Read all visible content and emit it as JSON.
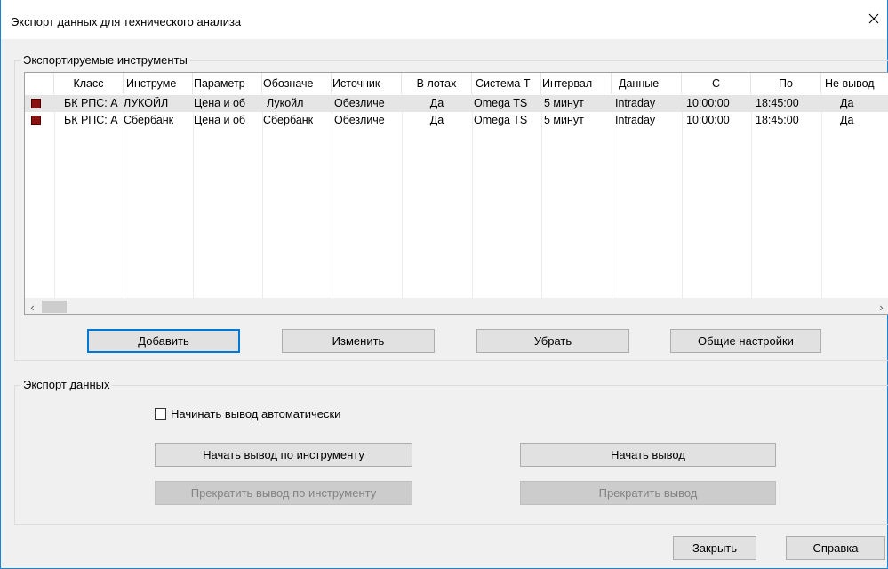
{
  "window": {
    "title": "Экспорт данных для технического анализа",
    "close_symbol": "✕"
  },
  "instruments_group": {
    "legend": "Экспортируемые инструменты",
    "columns": [
      "",
      "Класс",
      "Инструме",
      "Параметр",
      "Обозначе",
      "Источник",
      "В лотах",
      "Система Т",
      "Интервал",
      "Данные",
      "С",
      "По",
      "Не вывод"
    ],
    "rows": [
      {
        "selected": true,
        "icon": "instrument-icon",
        "cells": [
          "БК РПС: А",
          "ЛУКОЙЛ",
          "Цена и об",
          "Лукойл",
          "Обезличе",
          "Да",
          "Omega TS",
          "5 минут",
          "Intraday",
          "10:00:00",
          "18:45:00",
          "Да"
        ]
      },
      {
        "selected": false,
        "icon": "instrument-icon",
        "cells": [
          "БК РПС: А",
          "Сбербанк",
          "Цена и об",
          "Сбербанк",
          "Обезличе",
          "Да",
          "Omega TS",
          "5 минут",
          "Intraday",
          "10:00:00",
          "18:45:00",
          "Да"
        ]
      }
    ],
    "scroll_left": "‹",
    "scroll_right": "›",
    "buttons": {
      "add": "Добавить",
      "edit": "Изменить",
      "remove": "Убрать",
      "settings": "Общие настройки"
    }
  },
  "export_group": {
    "legend": "Экспорт данных",
    "auto_start_label": "Начинать вывод автоматически",
    "auto_start_checked": false,
    "buttons": {
      "start_instrument": "Начать вывод по инструменту",
      "start": "Начать вывод",
      "stop_instrument": "Прекратить вывод по инструменту",
      "stop": "Прекратить вывод"
    }
  },
  "footer": {
    "close": "Закрыть",
    "help": "Справка"
  }
}
